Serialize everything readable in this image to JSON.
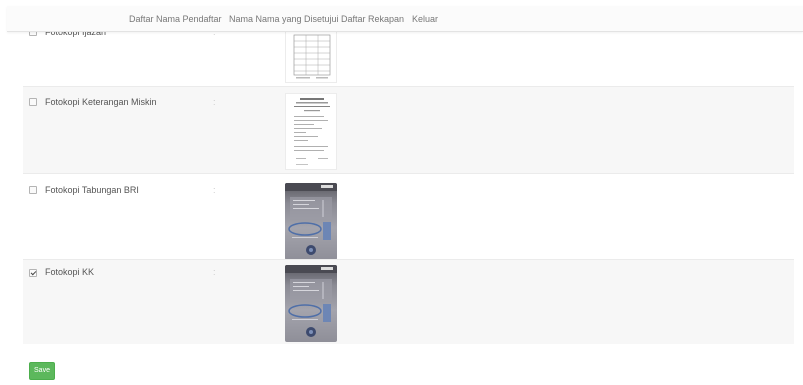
{
  "navbar": {
    "brand": "",
    "items": [
      {
        "label": "Daftar Nama Pendaftar"
      },
      {
        "label": "Nama Nama yang Disetujui"
      },
      {
        "label": "Daftar Rekapan"
      },
      {
        "label": "Keluar"
      }
    ]
  },
  "documents": [
    {
      "label": "Fotokopi Ijazah",
      "separator": ":",
      "checked": false,
      "thumbnail": "document-scan"
    },
    {
      "label": "Fotokopi Keterangan Miskin",
      "separator": ":",
      "checked": false,
      "thumbnail": "document-scan"
    },
    {
      "label": "Fotokopi Tabungan BRI",
      "separator": ":",
      "checked": false,
      "thumbnail": "bank-book-photo"
    },
    {
      "label": "Fotokopi KK",
      "separator": ":",
      "checked": true,
      "thumbnail": "bank-book-photo"
    }
  ],
  "form": {
    "save_label": "Save"
  },
  "colors": {
    "save_button": "#5cb85c",
    "row_alt_background": "#f7f7f7",
    "navbar_background": "#fbfbfb"
  }
}
